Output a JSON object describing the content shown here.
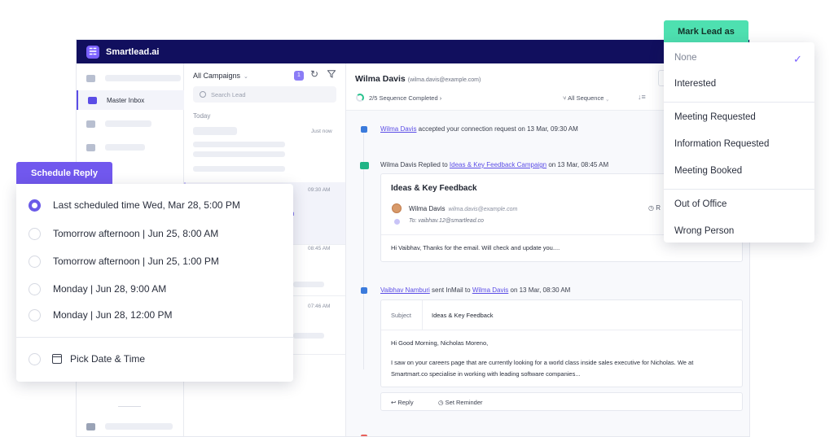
{
  "app": {
    "logo_glyph": "☵",
    "title": "Smartlead.ai"
  },
  "sidebar": {
    "active_label": "Master Inbox"
  },
  "lead_list": {
    "campaign_filter": "All Campaigns",
    "badge_count": "1",
    "search_placeholder": "Search Lead",
    "today_label": "Today",
    "items": [
      {
        "time": "Just now"
      },
      {
        "time": "09:30 AM",
        "fragment": "n"
      },
      {
        "time": "08:45 AM"
      },
      {
        "time": "07:46 AM"
      }
    ]
  },
  "conversation": {
    "lead_name": "Wilma Davis",
    "lead_email": "(wilma.davis@example.com)",
    "sequence_status": "2/5 Sequence Completed",
    "sequence_chevron": "›",
    "sequence_filter": "All Sequence",
    "events": [
      {
        "actor": "Wilma Davis",
        "text": " accepted your connection request on 13 Mar, 09:30 AM"
      },
      {
        "prefix": "Wilma Davis Replied to ",
        "link": "Ideas & Key Feedback Campaign",
        "suffix": " on 13 Mar, 08:45 AM"
      },
      {
        "actor": "Vaibhav Namburi",
        "middle": " sent InMail to ",
        "target": "Wilma Davis",
        "suffix": " on 13 Mar, 08:30 AM"
      }
    ],
    "reply_card": {
      "title": "Ideas & Key Feedback",
      "from_name": "Wilma Davis",
      "from_email": "wilma.davis@example.com",
      "to": "To: vaibhav.12@smartlead.co",
      "right_fragment": "R",
      "body": "Hi Vaibhav, Thanks for the email. Will check and update you...."
    },
    "inmail_card": {
      "subject_label": "Subject",
      "subject_value": "Ideas & Key Feedback",
      "greeting": "Hi Good Morning, Nicholas Moreno,",
      "body_line1": "I saw on your careers page that are currently looking for a world class inside sales executive for Nicholas. We at",
      "body_line2": "Smartmart.co specialise in working with leading software companies..."
    },
    "actions": {
      "reply": "Reply",
      "reminder": "Set Reminder"
    }
  },
  "schedule_reply": {
    "title": "Schedule Reply",
    "options": [
      {
        "label": "Last scheduled time Wed, Mar 28, 5:00 PM",
        "selected": true
      },
      {
        "label": "Tomorrow afternoon  |  Jun 25, 8:00 AM",
        "selected": false
      },
      {
        "label": "Tomorrow afternoon  |  Jun 25, 1:00 PM",
        "selected": false
      },
      {
        "label": "Monday  |  Jun 28, 9:00 AM",
        "selected": false
      },
      {
        "label": "Monday  |  Jun 28, 12:00 PM",
        "selected": false
      }
    ],
    "pick_label": "Pick Date & Time"
  },
  "mark_lead": {
    "title": "Mark Lead as",
    "selected": "None",
    "check_glyph": "✓",
    "items": [
      "None",
      "Interested",
      "Meeting Requested",
      "Information Requested",
      "Meeting Booked",
      "Out of Office",
      "Wrong Person"
    ]
  },
  "colors": {
    "topbar": "#110f5e",
    "accent": "#5b4de6",
    "schedule_tag": "#7158ee",
    "mark_tag": "#4ee0b0"
  }
}
